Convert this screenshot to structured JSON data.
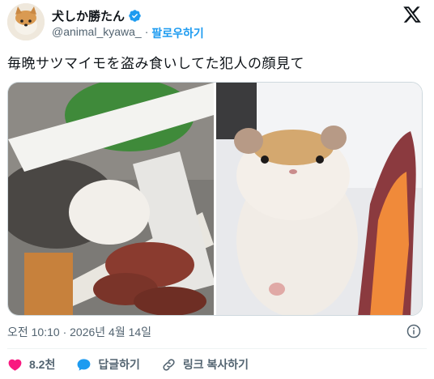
{
  "author": {
    "display_name": "犬しか勝たん",
    "handle": "@animal_kyawa_",
    "separator": "·",
    "follow_label": "팔로우하기"
  },
  "tweet": {
    "text": "毎晩サツマイモを盗み食いしてた犯人の顔見て"
  },
  "meta": {
    "timestamp": "오전 10:10 · 2026년 4월 14일"
  },
  "actions": {
    "like_count": "8.2천",
    "reply_label": "답글하기",
    "copy_link_label": "링크 복사하기"
  },
  "colors": {
    "accent": "#1d9bf0",
    "like": "#f91880",
    "muted": "#536471"
  },
  "icons": [
    "verified-badge-icon",
    "x-logo-icon",
    "info-icon",
    "heart-icon",
    "reply-bubble-icon",
    "link-icon"
  ]
}
